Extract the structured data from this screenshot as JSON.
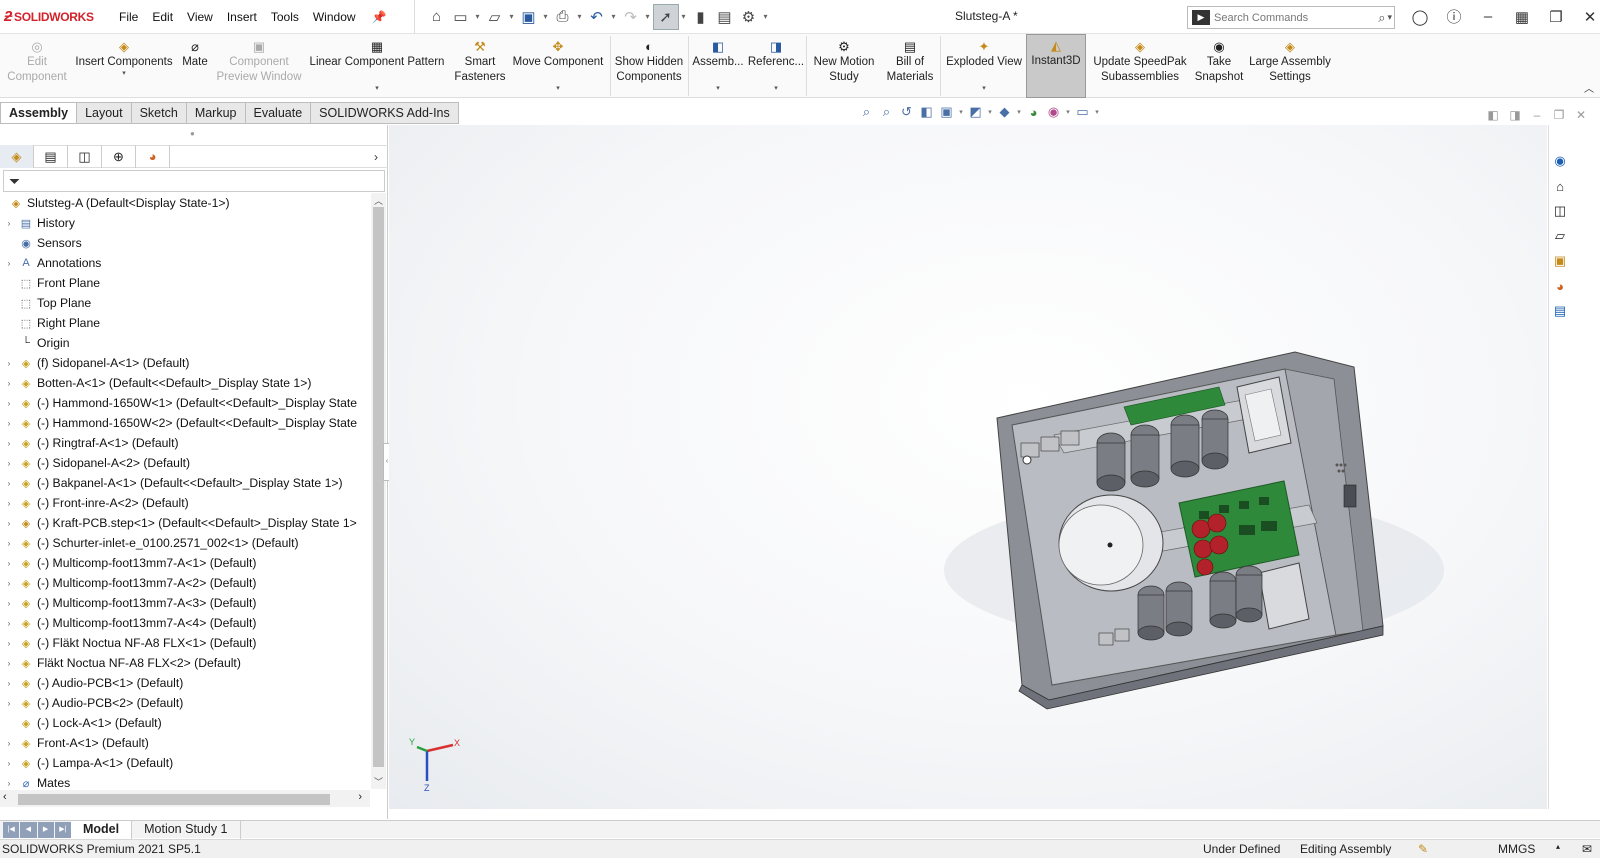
{
  "app": {
    "name": "SOLIDWORKS",
    "doc_title": "Slutsteg-A *"
  },
  "menu": [
    "File",
    "Edit",
    "View",
    "Insert",
    "Tools",
    "Window"
  ],
  "search": {
    "placeholder": "Search Commands"
  },
  "ribbon": {
    "edit_component": "Edit Component",
    "insert_components": "Insert Components",
    "mate": "Mate",
    "component_preview_window": "Component Preview Window",
    "linear_component_pattern": "Linear Component Pattern",
    "smart_fasteners": "Smart Fasteners",
    "move_component": "Move Component",
    "show_hidden_components": "Show Hidden Components",
    "assembly": "Assemb...",
    "reference": "Referenc...",
    "new_motion_study": "New Motion Study",
    "bill_of_materials": "Bill of Materials",
    "exploded_view": "Exploded View",
    "instant3d": "Instant3D",
    "update_speedpak": "Update SpeedPak Subassemblies",
    "take_snapshot": "Take Snapshot",
    "large_assembly_settings": "Large Assembly Settings"
  },
  "tabs": [
    "Assembly",
    "Layout",
    "Sketch",
    "Markup",
    "Evaluate",
    "SOLIDWORKS Add-Ins"
  ],
  "tree": [
    {
      "label": "Slutsteg-A  (Default<Display State-1>)",
      "expand": "",
      "icon": "assembly-icon"
    },
    {
      "label": "History",
      "expand": "›",
      "icon": "history-icon"
    },
    {
      "label": "Sensors",
      "expand": "",
      "icon": "sensors-icon"
    },
    {
      "label": "Annotations",
      "expand": "›",
      "icon": "annotations-icon"
    },
    {
      "label": "Front Plane",
      "expand": "",
      "icon": "plane-icon"
    },
    {
      "label": "Top Plane",
      "expand": "",
      "icon": "plane-icon"
    },
    {
      "label": "Right Plane",
      "expand": "",
      "icon": "plane-icon"
    },
    {
      "label": "Origin",
      "expand": "",
      "icon": "origin-icon"
    },
    {
      "label": "(f) Sidopanel-A<1> (Default)",
      "expand": "›",
      "icon": "part-icon"
    },
    {
      "label": "Botten-A<1> (Default<<Default>_Display State 1>)",
      "expand": "›",
      "icon": "part-icon"
    },
    {
      "label": "(-) Hammond-1650W<1> (Default<<Default>_Display State",
      "expand": "›",
      "icon": "part-icon"
    },
    {
      "label": "(-) Hammond-1650W<2> (Default<<Default>_Display State",
      "expand": "›",
      "icon": "part-icon"
    },
    {
      "label": "(-) Ringtraf-A<1> (Default)",
      "expand": "›",
      "icon": "part-icon"
    },
    {
      "label": "(-) Sidopanel-A<2> (Default)",
      "expand": "›",
      "icon": "part-icon"
    },
    {
      "label": "(-) Bakpanel-A<1> (Default<<Default>_Display State 1>)",
      "expand": "›",
      "icon": "part-icon"
    },
    {
      "label": "(-) Front-inre-A<2> (Default)",
      "expand": "›",
      "icon": "part-icon"
    },
    {
      "label": "(-) Kraft-PCB.step<1> (Default<<Default>_Display State 1>",
      "expand": "›",
      "icon": "subassembly-icon"
    },
    {
      "label": "(-) Schurter-inlet-e_0100.2571_002<1> (Default)",
      "expand": "›",
      "icon": "part-icon"
    },
    {
      "label": "(-) Multicomp-foot13mm7-A<1> (Default)",
      "expand": "›",
      "icon": "part-icon"
    },
    {
      "label": "(-) Multicomp-foot13mm7-A<2> (Default)",
      "expand": "›",
      "icon": "part-icon"
    },
    {
      "label": "(-) Multicomp-foot13mm7-A<3> (Default)",
      "expand": "›",
      "icon": "part-icon"
    },
    {
      "label": "(-) Multicomp-foot13mm7-A<4> (Default)",
      "expand": "›",
      "icon": "part-icon"
    },
    {
      "label": "(-) Fläkt Noctua NF-A8 FLX<1> (Default)",
      "expand": "›",
      "icon": "part-icon"
    },
    {
      "label": "Fläkt Noctua NF-A8 FLX<2> (Default)",
      "expand": "›",
      "icon": "part-icon"
    },
    {
      "label": "(-) Audio-PCB<1> (Default)",
      "expand": "›",
      "icon": "part-icon"
    },
    {
      "label": "(-) Audio-PCB<2> (Default)",
      "expand": "›",
      "icon": "part-icon"
    },
    {
      "label": "(-) Lock-A<1> (Default)",
      "expand": "",
      "icon": "part-icon"
    },
    {
      "label": "Front-A<1> (Default)",
      "expand": "›",
      "icon": "part-icon"
    },
    {
      "label": "(-) Lampa-A<1> (Default)",
      "expand": "›",
      "icon": "part-icon"
    },
    {
      "label": "Mates",
      "expand": "›",
      "icon": "mates-icon"
    }
  ],
  "bottom_tabs": [
    "Model",
    "Motion Study 1"
  ],
  "status": {
    "version": "SOLIDWORKS Premium 2021 SP5.1",
    "state": "Under Defined",
    "mode": "Editing Assembly",
    "units": "MMGS"
  },
  "triad": {
    "x": "X",
    "y": "Y",
    "z": "Z"
  }
}
